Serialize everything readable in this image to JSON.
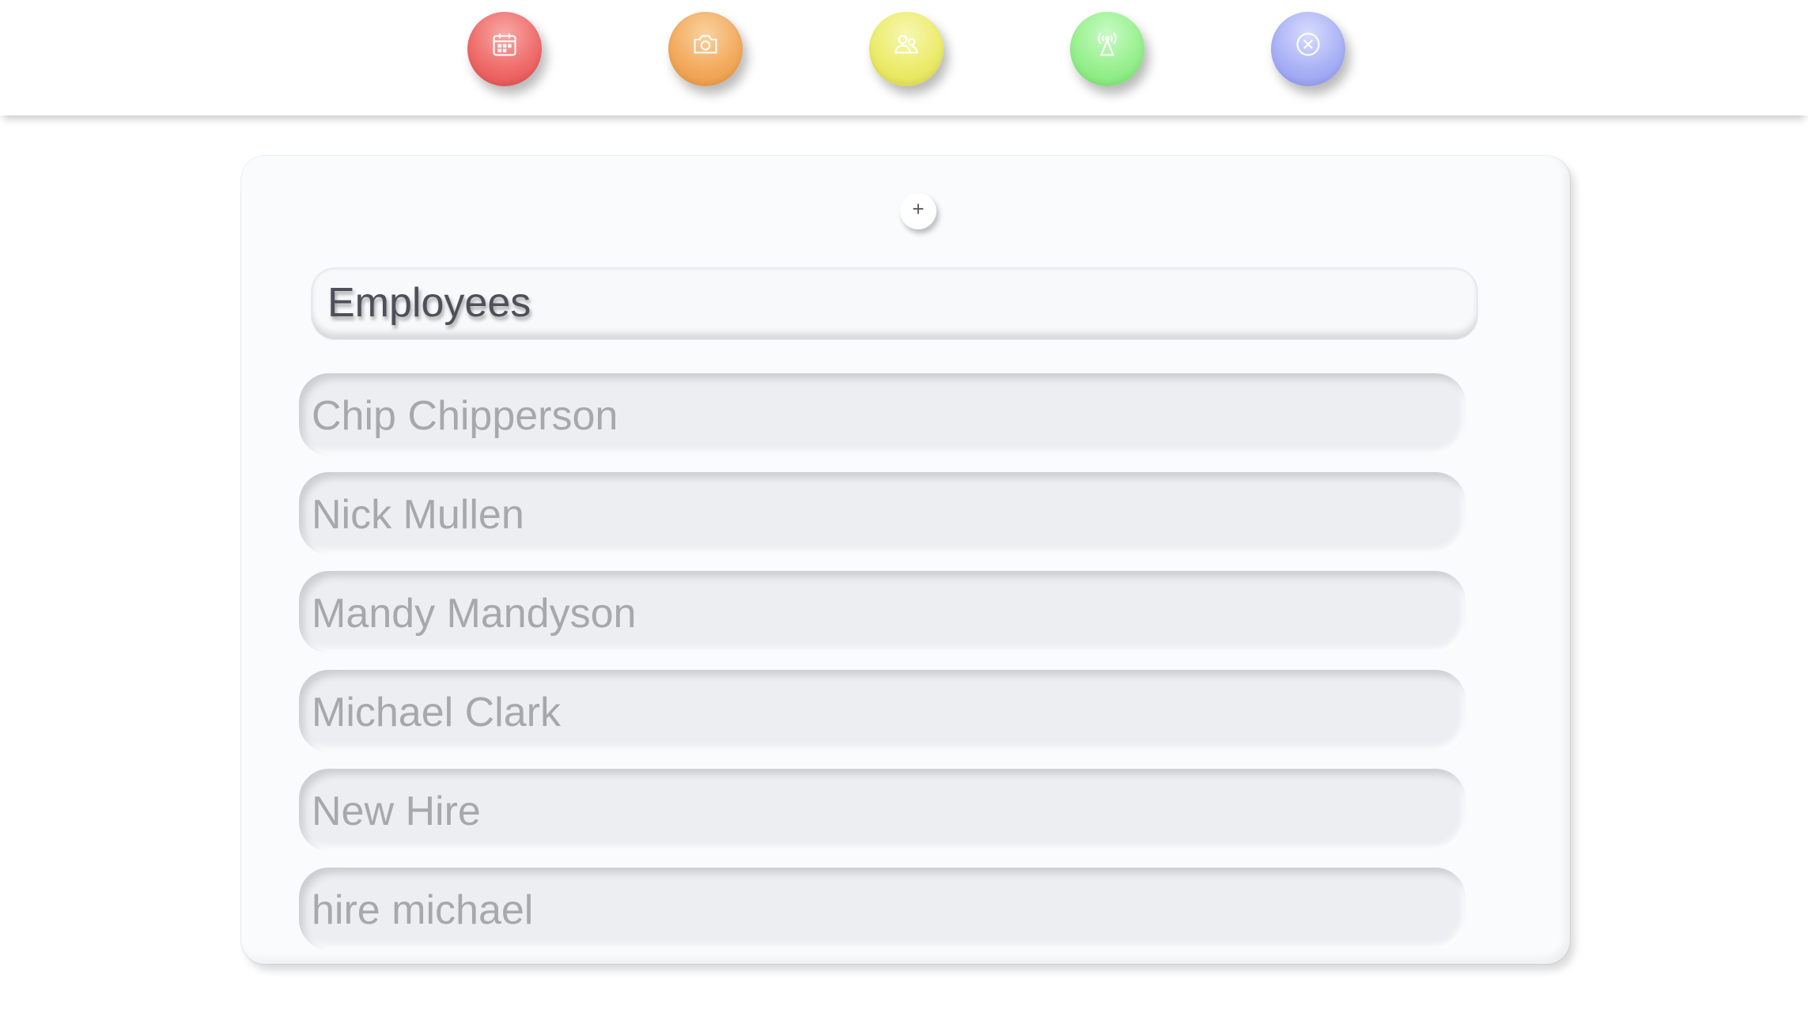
{
  "nav": {
    "buttons": [
      {
        "icon": "calendar-icon",
        "color": "#ef6d6b"
      },
      {
        "icon": "camera-icon",
        "color": "#f3ab5f"
      },
      {
        "icon": "users-icon",
        "color": "#ecec6d"
      },
      {
        "icon": "broadcast-tower-icon",
        "color": "#98f08e"
      },
      {
        "icon": "close-circle-icon",
        "color": "#aab2f6"
      }
    ]
  },
  "panel": {
    "add_label": "+",
    "title": "Employees",
    "employees": [
      {
        "name": "Chip Chipperson"
      },
      {
        "name": "Nick Mullen"
      },
      {
        "name": "Mandy Mandyson"
      },
      {
        "name": "Michael Clark"
      },
      {
        "name": "New Hire"
      },
      {
        "name": "hire michael"
      }
    ]
  }
}
